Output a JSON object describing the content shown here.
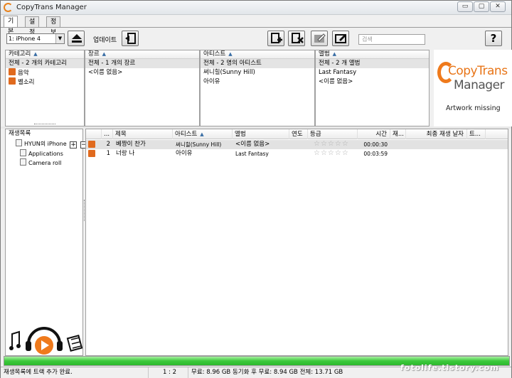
{
  "window": {
    "title": "CopyTrans Manager",
    "minimize_glyph": "▭",
    "maximize_glyph": "▢",
    "close_glyph": "✕"
  },
  "tabs": [
    {
      "label": "기본"
    },
    {
      "label": "설정"
    },
    {
      "label": "정보"
    }
  ],
  "toolbar": {
    "device": "1: iPhone 4",
    "update_label": "업데이트",
    "search_placeholder": "검색",
    "help_glyph": "?"
  },
  "browser": {
    "category": {
      "header": "카테고리",
      "rows": [
        "전체 - 2 개의 카테고리",
        "음악",
        "벨소리"
      ]
    },
    "genre": {
      "header": "장르",
      "rows": [
        "전체 - 1 개의 장르",
        "<이름 없음>"
      ]
    },
    "artist": {
      "header": "아티스트",
      "rows": [
        "전체 - 2 명의 아티스트",
        "써니힐(Sunny Hill)",
        "아이유"
      ]
    },
    "album": {
      "header": "앨범",
      "rows": [
        "전체 - 2 개 앨범",
        "Last Fantasy",
        "<이름 없음>"
      ]
    },
    "artwork_missing": "Artwork missing"
  },
  "logo": {
    "copy": "CopyTrans",
    "manager": "Manager"
  },
  "playlists": {
    "header": "재생목록",
    "device_name": "HYUN의 iPhone",
    "items": [
      "Applications",
      "Camera roll"
    ],
    "add_glyph": "+",
    "remove_glyph": "−"
  },
  "tracks": {
    "columns": {
      "num": "...",
      "title": "제목",
      "artist": "아티스트",
      "album": "앨범",
      "year": "연도",
      "rating": "등급",
      "time": "시간",
      "play": "재...",
      "last_played": "최종 재생 날자",
      "type": "트..."
    },
    "rows": [
      {
        "num": "2",
        "title": "베짱이 찬가",
        "artist": "써니힐(Sunny Hill)",
        "album": "<이름 없음>",
        "year": "",
        "rating": "☆☆☆☆☆",
        "time": "00:00:30"
      },
      {
        "num": "1",
        "title": "너랑 나",
        "artist": "아이유",
        "album": "Last Fantasy",
        "year": "",
        "rating": "☆☆☆☆☆",
        "time": "00:03:59"
      }
    ]
  },
  "progress": {
    "fill_fraction": 1.0,
    "color": "#3cc93c"
  },
  "status": {
    "message": "재생목록에 트랙 추가 완료.",
    "ratio": "1 : 2",
    "space": "무료: 8.96 GB 동기화 후 무료: 8.94 GB 전체: 13.71 GB"
  },
  "watermark": "fotolife.tistory.com",
  "colors": {
    "accent_orange": "#ef7a1c",
    "progress_green": "#3cc93c"
  }
}
